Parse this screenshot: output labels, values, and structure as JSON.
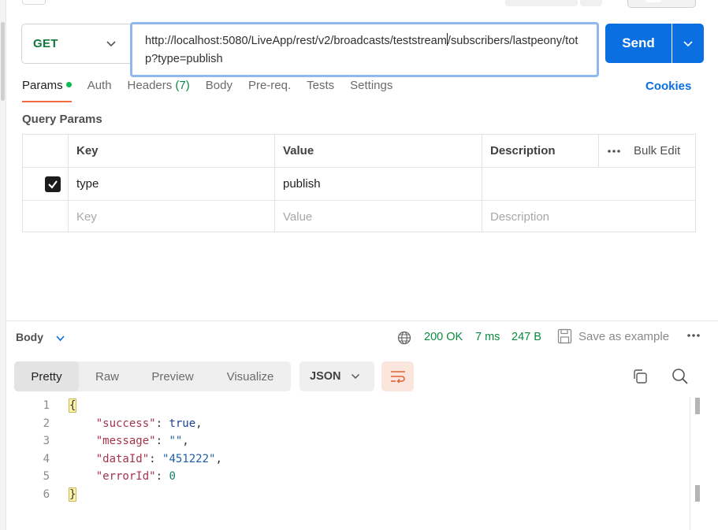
{
  "request": {
    "method": "GET",
    "url_part1": "http://localhost:5080/LiveApp/rest/v2/broadcasts/teststream",
    "url_part2": "/subscribers/lastpeony/totp?type=publish",
    "send_label": "Send"
  },
  "tabs": [
    {
      "label": "Params"
    },
    {
      "label": "Auth"
    },
    {
      "label": "Headers",
      "count": "(7)"
    },
    {
      "label": "Body"
    },
    {
      "label": "Pre-req."
    },
    {
      "label": "Tests"
    },
    {
      "label": "Settings"
    }
  ],
  "cookies_label": "Cookies",
  "query_params": {
    "title": "Query Params",
    "headers": {
      "key": "Key",
      "value": "Value",
      "description": "Description",
      "bulk_edit": "Bulk Edit"
    },
    "rows": [
      {
        "key": "type",
        "value": "publish",
        "description": "",
        "checked": true
      }
    ],
    "placeholders": {
      "key": "Key",
      "value": "Value",
      "description": "Description"
    }
  },
  "response": {
    "body_label": "Body",
    "status": "200 OK",
    "time": "7 ms",
    "size": "247 B",
    "save_label": "Save as example",
    "view_tabs": [
      "Pretty",
      "Raw",
      "Preview",
      "Visualize"
    ],
    "format": "JSON",
    "lines": [
      {
        "n": "1"
      },
      {
        "n": "2"
      },
      {
        "n": "3"
      },
      {
        "n": "4"
      },
      {
        "n": "5"
      },
      {
        "n": "6"
      }
    ],
    "json": {
      "open": "{",
      "close": "}",
      "k_success": "\"success\"",
      "v_success": "true",
      "k_message": "\"message\"",
      "v_message": "\"\"",
      "k_dataId": "\"dataId\"",
      "v_dataId": "\"451222\"",
      "k_errorId": "\"errorId\"",
      "v_errorId": "0"
    }
  },
  "colors": {
    "accent": "#0a6fe0",
    "method": "#0b7a3b",
    "status": "#0b8a3f",
    "active_tab_underline": "#f26b3a"
  }
}
